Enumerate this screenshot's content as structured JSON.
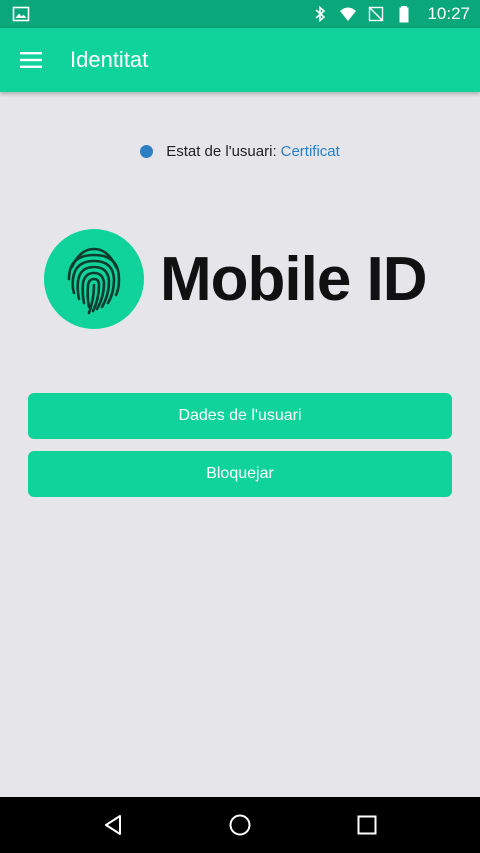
{
  "status_bar": {
    "time": "10:27",
    "icons": [
      "image-icon",
      "bluetooth-icon",
      "wifi-icon",
      "signal-off-icon",
      "battery-icon"
    ]
  },
  "app_bar": {
    "title": "Identitat",
    "menu_icon": "hamburger-menu-icon"
  },
  "user_status": {
    "label": "Estat de l'usuari:",
    "value": "Certificat",
    "dot_color": "#2b7fc2"
  },
  "logo": {
    "text": "Mobile ID",
    "icon": "fingerprint-icon"
  },
  "actions": {
    "user_data_label": "Dades de l'usuari",
    "block_label": "Bloquejar"
  },
  "nav_bar": {
    "icons": [
      "back-icon",
      "home-icon",
      "recents-icon"
    ]
  },
  "colors": {
    "accent": "#10d39b",
    "status_bar": "#0aa77a",
    "background": "#e6e6ea",
    "link": "#2b7fc2"
  }
}
